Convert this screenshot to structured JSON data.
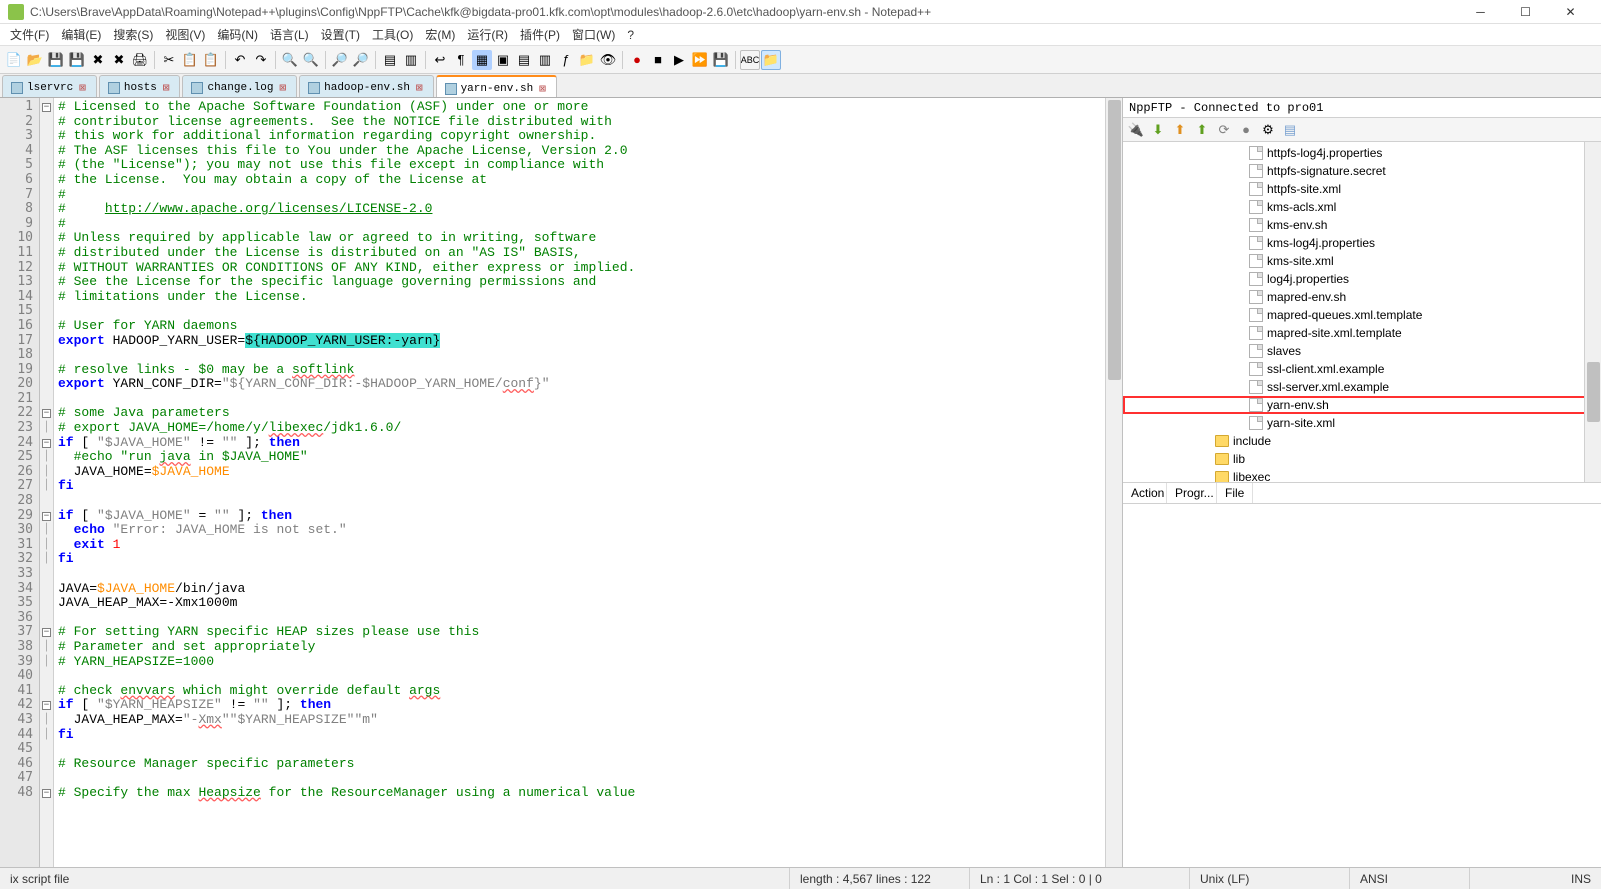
{
  "title": "C:\\Users\\Brave\\AppData\\Roaming\\Notepad++\\plugins\\Config\\NppFTP\\Cache\\kfk@bigdata-pro01.kfk.com\\opt\\modules\\hadoop-2.6.0\\etc\\hadoop\\yarn-env.sh - Notepad++",
  "menus": [
    "文件(F)",
    "编辑(E)",
    "搜索(S)",
    "视图(V)",
    "编码(N)",
    "语言(L)",
    "设置(T)",
    "工具(O)",
    "宏(M)",
    "运行(R)",
    "插件(P)",
    "窗口(W)",
    "?"
  ],
  "tabs": [
    {
      "label": "lservrc",
      "close": "⊠",
      "active": false
    },
    {
      "label": "hosts",
      "close": "⊠",
      "active": false
    },
    {
      "label": "change.log",
      "close": "⊠",
      "active": false
    },
    {
      "label": "hadoop-env.sh",
      "close": "⊠",
      "active": false
    },
    {
      "label": "yarn-env.sh",
      "close": "⊠",
      "active": true
    }
  ],
  "lines": [
    "1",
    "2",
    "3",
    "4",
    "5",
    "6",
    "7",
    "8",
    "9",
    "10",
    "11",
    "12",
    "13",
    "14",
    "15",
    "16",
    "17",
    "18",
    "19",
    "20",
    "21",
    "22",
    "23",
    "24",
    "25",
    "26",
    "27",
    "28",
    "29",
    "30",
    "31",
    "32",
    "33",
    "34",
    "35",
    "36",
    "37",
    "38",
    "39",
    "40",
    "41",
    "42",
    "43",
    "44",
    "45",
    "46",
    "47",
    "48"
  ],
  "code": {
    "l1": "# Licensed to the Apache Software Foundation (ASF) under one or more",
    "l2": "# contributor license agreements.  See the NOTICE file distributed with",
    "l3": "# this work for additional information regarding copyright ownership.",
    "l4": "# The ASF licenses this file to You under the Apache License, Version 2.0",
    "l5": "# (the \"License\"); you may not use this file except in compliance with",
    "l6": "# the License.  You may obtain a copy of the License at",
    "l7": "#",
    "l8a": "#     ",
    "l8b": "http://www.apache.org/licenses/LICENSE-2.0",
    "l9": "#",
    "l10": "# Unless required by applicable law or agreed to in writing, software",
    "l11": "# distributed under the License is distributed on an \"AS IS\" BASIS,",
    "l12": "# WITHOUT WARRANTIES OR CONDITIONS OF ANY KIND, either express or implied.",
    "l13": "# See the License for the specific language governing permissions and",
    "l14": "# limitations under the License.",
    "l16": "# User for YARN daemons",
    "l17a": "export",
    "l17b": " HADOOP_YARN_USER=",
    "l17c": "${HADOOP_YARN_USER:-yarn}",
    "l19a": "# resolve links - $0 may be a ",
    "l19b": "softlink",
    "l20a": "export",
    "l20b": " YARN_CONF_DIR=",
    "l20c": "\"${YARN_CONF_DIR:-$HADOOP_YARN_HOME/",
    "l20d": "conf",
    "l20e": "}\"",
    "l22": "# some Java parameters",
    "l23a": "# export JAVA_HOME=/home/y/",
    "l23b": "libexec",
    "l23c": "/jdk1.6.0/",
    "l24a": "if",
    "l24b": " [ ",
    "l24c": "\"$JAVA_HOME\"",
    "l24d": " != ",
    "l24e": "\"\"",
    "l24f": " ]; ",
    "l24g": "then",
    "l25a": "  #echo \"run ",
    "l25b": "java",
    "l25c": " in $JAVA_HOME\"",
    "l26a": "  JAVA_HOME=",
    "l26b": "$JAVA_HOME",
    "l27": "fi",
    "l29a": "if",
    "l29b": " [ ",
    "l29c": "\"$JAVA_HOME\"",
    "l29d": " = ",
    "l29e": "\"\"",
    "l29f": " ]; ",
    "l29g": "then",
    "l30a": "  echo",
    "l30b": " \"Error: JAVA_HOME is not set.\"",
    "l31a": "  exit",
    "l31b": " 1",
    "l32": "fi",
    "l34a": "JAVA=",
    "l34b": "$JAVA_HOME",
    "l34c": "/bin/java",
    "l35": "JAVA_HEAP_MAX=-Xmx1000m",
    "l37": "# For setting YARN specific HEAP sizes please use this",
    "l38": "# Parameter and set appropriately",
    "l39": "# YARN_HEAPSIZE=1000",
    "l41a": "# check ",
    "l41b": "envvars",
    "l41c": " which might override default ",
    "l41d": "args",
    "l42a": "if",
    "l42b": " [ ",
    "l42c": "\"$YARN_HEAPSIZE\"",
    "l42d": " != ",
    "l42e": "\"\"",
    "l42f": " ]; ",
    "l42g": "then",
    "l43a": "  JAVA_HEAP_MAX=",
    "l43b": "\"-",
    "l43c": "Xmx",
    "l43d": "\"\"$YARN_HEAPSIZE\"\"m\"",
    "l44": "fi",
    "l46": "# Resource Manager specific parameters",
    "l48a": "# Specify the max ",
    "l48b": "Heapsize",
    "l48c": " for the ResourceManager using a numerical value"
  },
  "side": {
    "title": "NppFTP - Connected to pro01",
    "files": [
      "httpfs-log4j.properties",
      "httpfs-signature.secret",
      "httpfs-site.xml",
      "kms-acls.xml",
      "kms-env.sh",
      "kms-log4j.properties",
      "kms-site.xml",
      "log4j.properties",
      "mapred-env.sh",
      "mapred-queues.xml.template",
      "mapred-site.xml.template",
      "slaves",
      "ssl-client.xml.example",
      "ssl-server.xml.example",
      "yarn-env.sh",
      "yarn-site.xml"
    ],
    "folders": [
      "include",
      "lib",
      "libexec"
    ],
    "cols": [
      "Action",
      "Progr...",
      "File"
    ]
  },
  "status": {
    "type": "ix script file",
    "length": "length : 4,567    lines : 122",
    "pos": "Ln : 1    Col : 1    Sel : 0 | 0",
    "eol": "Unix (LF)",
    "enc": "ANSI",
    "ins": "INS"
  }
}
